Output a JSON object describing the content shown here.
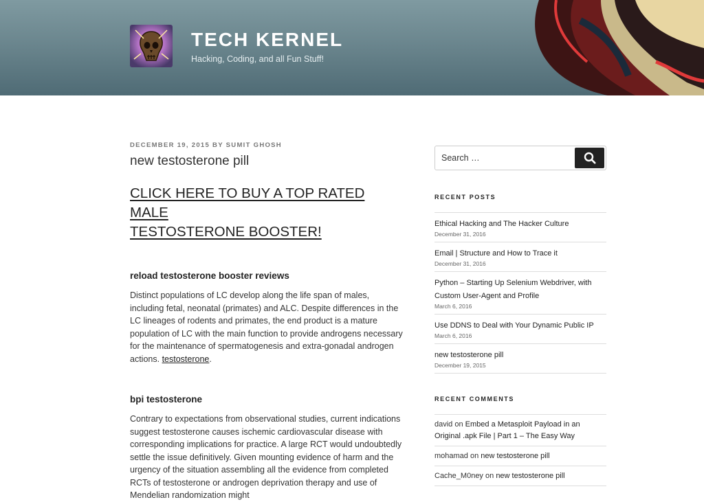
{
  "header": {
    "site_title": "TECH KERNEL",
    "tagline": "Hacking, Coding, and all Fun Stuff!"
  },
  "post": {
    "date": "DECEMBER 19, 2015",
    "by": "BY",
    "author": "SUMIT GHOSH",
    "title": "new testosterone pill",
    "cta_line1": "CLICK HERE TO BUY A TOP RATED MALE",
    "cta_line2": "TESTOSTERONE BOOSTER!",
    "sections": [
      {
        "heading": "reload testosterone booster reviews",
        "body": "Distinct populations of LC develop along the life span of males, including fetal, neonatal (primates) and ALC. Despite differences in the LC lineages of rodents and primates, the end product is a mature population of LC with the main function to provide androgens necessary for the maintenance of spermatogenesis and extra-gonadal androgen actions.",
        "link": "testosterone",
        "after_link": "."
      },
      {
        "heading": "bpi testosterone",
        "body": "Contrary to expectations from observational studies, current indications suggest testosterone causes ischemic cardiovascular disease with corresponding implications for practice. A large RCT would undoubtedly settle the issue definitively. Given mounting evidence of harm and the urgency of the situation assembling all the evidence from completed RCTs of testosterone or androgen deprivation therapy and use of Mendelian randomization might"
      }
    ]
  },
  "sidebar": {
    "search": {
      "placeholder": "Search …"
    },
    "recent_posts": {
      "title": "RECENT POSTS",
      "items": [
        {
          "title": "Ethical Hacking and The Hacker Culture",
          "date": "December 31, 2016"
        },
        {
          "title": "Email | Structure and How to Trace it",
          "date": "December 31, 2016"
        },
        {
          "title": "Python – Starting Up Selenium Webdriver, with Custom User-Agent and Profile",
          "date": "March 6, 2016"
        },
        {
          "title": "Use DDNS to Deal with Your Dynamic Public IP",
          "date": "March 6, 2016"
        },
        {
          "title": "new testosterone pill",
          "date": "December 19, 2015"
        }
      ]
    },
    "recent_comments": {
      "title": "RECENT COMMENTS",
      "on": "on",
      "items": [
        {
          "author": "david",
          "post": "Embed a Metasploit Payload in an Original .apk File | Part 1 – The Easy Way"
        },
        {
          "author": "mohamad",
          "post": "new testosterone pill"
        },
        {
          "author": "Cache_M0ney",
          "post": "new testosterone pill"
        }
      ]
    }
  },
  "icons": {
    "search": "search-icon",
    "logo": "skull-logo"
  },
  "colors": {
    "header": "#6b868e",
    "accent_dark": "#222222"
  }
}
